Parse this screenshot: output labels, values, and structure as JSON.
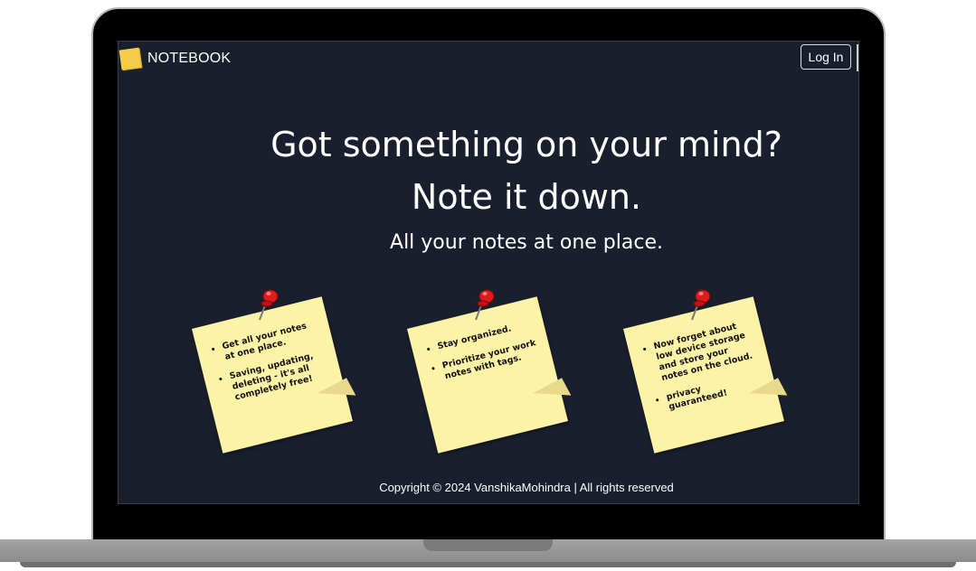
{
  "navbar": {
    "brand_name": "NOTEBOOK",
    "brand_icon": "sticky-note-icon",
    "login_label": "Log In"
  },
  "hero": {
    "line1": "Got something on your mind?",
    "line2": "Note it down.",
    "subtitle": "All your notes at one place."
  },
  "notes": [
    {
      "items": [
        "Get all your notes at one place.",
        "Saving, updating, deleting - it's all completely free!"
      ]
    },
    {
      "items": [
        "Stay organized.",
        "Prioritize your work notes with tags."
      ]
    },
    {
      "items": [
        "Now forget about low device storage and store your notes on the cloud.",
        "privacy guaranteed!"
      ]
    }
  ],
  "footer": {
    "copyright": "Copyright © 2024 VanshikaMohindra | All rights reserved"
  },
  "colors": {
    "background": "#1a1f2e",
    "note": "#fdf3a6",
    "pin": "#e01b1b",
    "brand_icon": "#f5cc45"
  }
}
